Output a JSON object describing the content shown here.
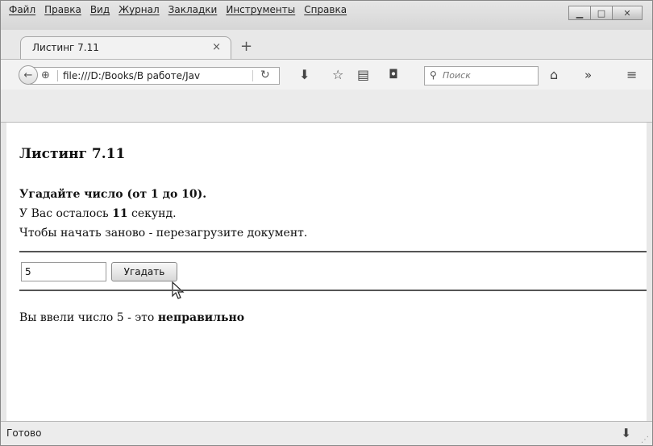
{
  "menu": [
    "Файл",
    "Правка",
    "Вид",
    "Журнал",
    "Закладки",
    "Инструменты",
    "Справка"
  ],
  "tab": {
    "title": "Листинг 7.11",
    "close": "×",
    "new_tab": "+"
  },
  "navbar": {
    "url": "file:///D:/Books/В работе/Jav",
    "search_placeholder": "Поиск",
    "overflow": "»"
  },
  "page": {
    "heading": "Листинг 7.11",
    "prompt": "Угадайте число (от 1 до 10).",
    "time_prefix": "У Вас осталось ",
    "seconds": "11",
    "time_suffix": " секунд.",
    "restart_hint": "Чтобы начать заново - перезагрузите документ.",
    "input_value": "5",
    "guess_button": "Угадать",
    "result_prefix": "Вы ввели число 5 - это ",
    "result_word": "неправильно"
  },
  "status": {
    "text": "Готово"
  }
}
